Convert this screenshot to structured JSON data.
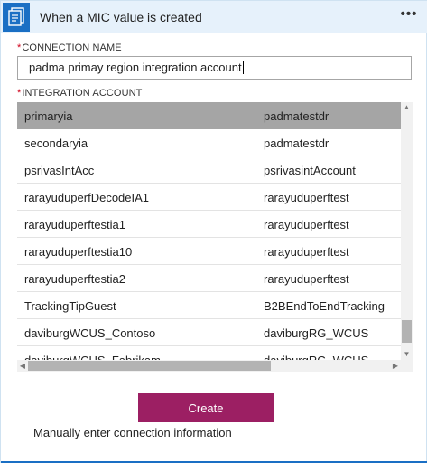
{
  "header": {
    "title": "When a MIC value is created",
    "menu_label": "•••"
  },
  "connection_name": {
    "label": "CONNECTION NAME",
    "required_mark": "*",
    "value": "padma primay region integration account"
  },
  "integration_account": {
    "label": "INTEGRATION ACCOUNT",
    "required_mark": "*",
    "rows": [
      {
        "name": "primaryia",
        "group": "padmatestdr",
        "selected": true
      },
      {
        "name": "secondaryia",
        "group": "padmatestdr",
        "selected": false
      },
      {
        "name": "psrivasIntAcc",
        "group": "psrivasintAccount",
        "selected": false
      },
      {
        "name": "rarayuduperfDecodeIA1",
        "group": "rarayuduperftest",
        "selected": false
      },
      {
        "name": "rarayuduperftestia1",
        "group": "rarayuduperftest",
        "selected": false
      },
      {
        "name": "rarayuduperftestia10",
        "group": "rarayuduperftest",
        "selected": false
      },
      {
        "name": "rarayuduperftestia2",
        "group": "rarayuduperftest",
        "selected": false
      },
      {
        "name": "TrackingTipGuest",
        "group": "B2BEndToEndTracking",
        "selected": false
      },
      {
        "name": "daviburgWCUS_Contoso",
        "group": "daviburgRG_WCUS",
        "selected": false
      },
      {
        "name": "daviburgWCUS_Fabrikam",
        "group": "daviburgRG_WCUS",
        "selected": false
      }
    ]
  },
  "actions": {
    "create_label": "Create",
    "manual_label": "Manually enter connection information"
  },
  "icons": {
    "app": "document-list-icon",
    "more": "more-icon"
  },
  "colors": {
    "header_bg": "#e6f1fb",
    "accent": "#1a6fc4",
    "create_button": "#9c1f63",
    "selected_row": "#a5a5a5",
    "required": "#d0021b"
  }
}
